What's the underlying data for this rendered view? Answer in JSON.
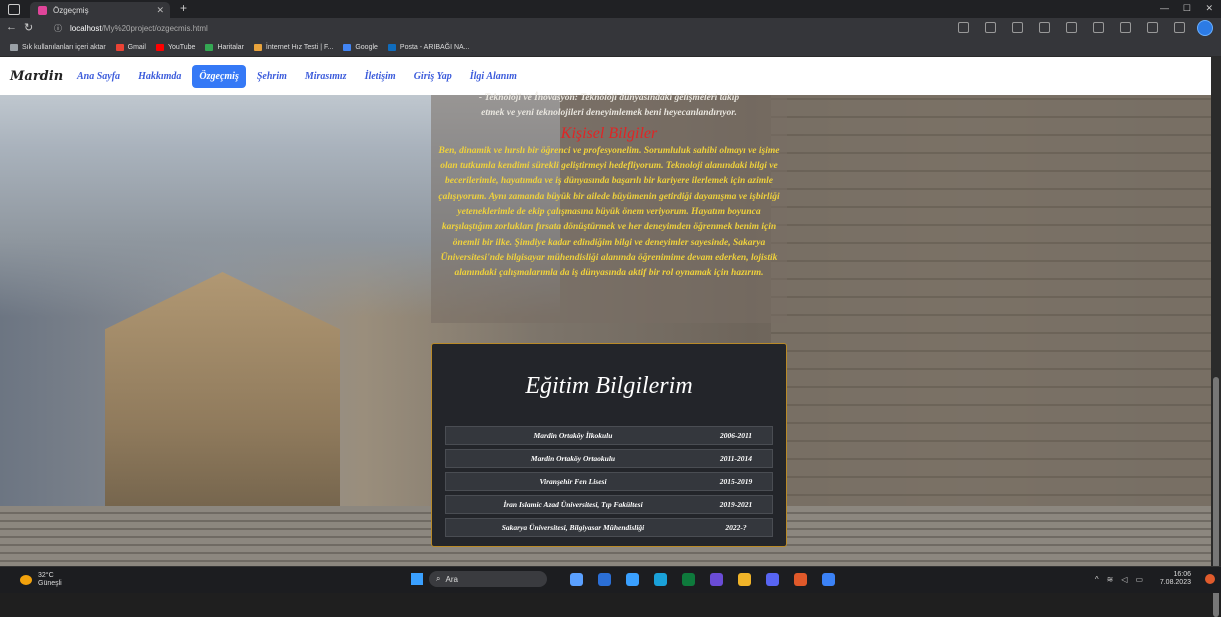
{
  "browser": {
    "tab_title": "Özgeçmiş",
    "url_host": "localhost",
    "url_path": "/My%20project/ozgecmis.html",
    "bookmarks": [
      {
        "label": "Sık kullanılanları içeri aktar",
        "color": "#9aa0a6"
      },
      {
        "label": "Gmail",
        "color": "#ea4335"
      },
      {
        "label": "YouTube",
        "color": "#ff0000"
      },
      {
        "label": "Haritalar",
        "color": "#34a853"
      },
      {
        "label": "İnternet Hız Testi | F...",
        "color": "#e8a33c"
      },
      {
        "label": "Google",
        "color": "#4285f4"
      },
      {
        "label": "Posta - ARIBAĞI NA...",
        "color": "#0f6cbd"
      }
    ]
  },
  "navbar": {
    "logo": "Mardin",
    "links": [
      "Ana Sayfa",
      "Hakkımda",
      "Özgeçmiş",
      "Şehrim",
      "Mirasımız",
      "İletişim",
      "Giriş Yap",
      "İlgi Alanım"
    ],
    "active_index": 2
  },
  "info": {
    "top_line1": "- Teknoloji ve İnovasyon: Teknoloji dünyasındaki gelişmeleri takip",
    "top_line2": "etmek ve yeni teknolojileri deneyimlemek beni heyecanlandırıyor.",
    "heading": "Kişisel Bilgiler",
    "paragraph": "Ben, dinamik ve hırslı bir öğrenci ve profesyonelim. Sorumluluk sahibi olmayı ve işime olan tutkumla kendimi sürekli geliştirmeyi hedefliyorum. Teknoloji alanındaki bilgi ve becerilerimle, hayatımda ve iş dünyasında başarılı bir kariyere ilerlemek için azimle çalışıyorum. Aynı zamanda büyük bir ailede büyümenin getirdiği dayanışma ve işbirliği yeteneklerimle de ekip çalışmasına büyük önem veriyorum. Hayatım boyunca karşılaştığım zorlukları fırsata dönüştürmek ve her deneyimden öğrenmek benim için önemli bir ilke. Şimdiye kadar edindiğim bilgi ve deneyimler sayesinde, Sakarya Üniversitesi'nde bilgisayar mühendisliği alanında öğrenimime devam ederken, lojistik alanındaki çalışmalarımla da iş dünyasında aktif bir rol oynamak için hazırım."
  },
  "education": {
    "heading": "Eğitim Bilgilerim",
    "rows": [
      {
        "school": "Mardin Ortaköy İlkokulu",
        "years": "2006-2011"
      },
      {
        "school": "Mardin Ortaköy Ortaokulu",
        "years": "2011-2014"
      },
      {
        "school": "Viranşehir Fen Lisesi",
        "years": "2015-2019"
      },
      {
        "school": "İran Islamic Azad Üniversitesi, Tıp Fakültesi",
        "years": "2019-2021"
      },
      {
        "school": "Sakarya Üniversitesi, Bilgiyasar Mühendisliği",
        "years": "2022-?"
      }
    ]
  },
  "taskbar": {
    "temp": "32°C",
    "weather": "Güneşli",
    "search_placeholder": "Ara",
    "time": "16:06",
    "date": "7.08.2023",
    "app_colors": [
      "#5aa0ff",
      "#2b6fd6",
      "#3aa0ff",
      "#1aa1d9",
      "#0e7a3c",
      "#6a4cd6",
      "#f0b429",
      "#5865f2",
      "#e0592a",
      "#3b82f6"
    ]
  }
}
